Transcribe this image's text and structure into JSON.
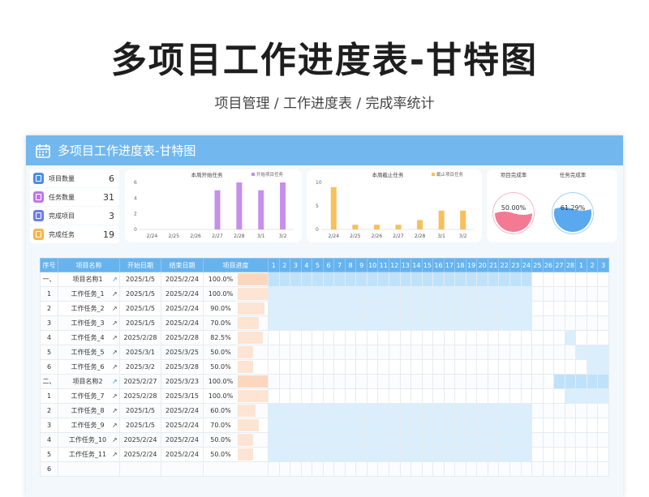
{
  "page": {
    "title": "多项目工作进度表-甘特图",
    "subtitle": "项目管理 / 工作进度表 / 完成率统计"
  },
  "window": {
    "title": "多项目工作进度表-甘特图",
    "icon": "calendar-icon"
  },
  "stats": [
    {
      "label": "项目数量",
      "value": "6",
      "color": "#4a8fe8"
    },
    {
      "label": "任务数量",
      "value": "31",
      "color": "#c077e6"
    },
    {
      "label": "完成项目",
      "value": "3",
      "color": "#6b7ee8"
    },
    {
      "label": "完成任务",
      "value": "19",
      "color": "#f5b54a"
    }
  ],
  "chart_data": [
    {
      "type": "bar",
      "title": "本周开始任务",
      "legend": "开始项目任务",
      "categories": [
        "2/24",
        "2/25",
        "2/26",
        "2/27",
        "2/28",
        "3/1",
        "3/2"
      ],
      "values": [
        0,
        0,
        0,
        5,
        6,
        5,
        6
      ],
      "ylim": [
        0,
        6
      ],
      "yticks": [
        0,
        2,
        4,
        6
      ],
      "color": "#c68fec"
    },
    {
      "type": "bar",
      "title": "本周截止任务",
      "legend": "截止项目任务",
      "categories": [
        "2/24",
        "2/25",
        "2/26",
        "2/27",
        "2/28",
        "3/1",
        "3/2"
      ],
      "values": [
        9,
        1,
        1,
        1,
        2,
        4,
        4
      ],
      "ylim": [
        0,
        10
      ],
      "yticks": [
        0,
        5,
        10
      ],
      "color": "#f8bf5c"
    }
  ],
  "gauges": [
    {
      "title": "项目完成率",
      "value": 0.5,
      "label": "50.00%",
      "color": "#f47a94"
    },
    {
      "title": "任务完成率",
      "value": 0.6129,
      "label": "61.29%",
      "color": "#5aa9ee"
    }
  ],
  "table": {
    "headers": [
      "序号",
      "项目名称",
      "开始日期",
      "结束日期",
      "项目进度"
    ],
    "days": [
      "1",
      "2",
      "3",
      "4",
      "5",
      "6",
      "7",
      "8",
      "9",
      "10",
      "11",
      "12",
      "13",
      "14",
      "15",
      "16",
      "17",
      "18",
      "19",
      "20",
      "21",
      "22",
      "23",
      "24",
      "25",
      "26",
      "27",
      "28",
      "1",
      "2",
      "3"
    ],
    "rows": [
      {
        "no": "一、",
        "name": "项目名称1",
        "start": "2025/1/5",
        "end": "2025/2/24",
        "pct": "100.0%",
        "p": 1.0,
        "proj": true,
        "on": [
          1,
          24
        ],
        "dark": true
      },
      {
        "no": "1",
        "name": "工作任务_1",
        "start": "2025/1/5",
        "end": "2025/2/24",
        "pct": "100.0%",
        "p": 1.0,
        "on": [
          1,
          24
        ]
      },
      {
        "no": "2",
        "name": "工作任务_2",
        "start": "2025/1/5",
        "end": "2025/2/24",
        "pct": "90.0%",
        "p": 0.9,
        "on": [
          1,
          24
        ]
      },
      {
        "no": "3",
        "name": "工作任务_3",
        "start": "2025/1/5",
        "end": "2025/2/24",
        "pct": "70.0%",
        "p": 0.7,
        "on": [
          1,
          24
        ]
      },
      {
        "no": "4",
        "name": "工作任务_4",
        "start": "2025/2/28",
        "end": "2025/2/28",
        "pct": "82.5%",
        "p": 0.825,
        "on": [
          28,
          28
        ]
      },
      {
        "no": "5",
        "name": "工作任务_5",
        "start": "2025/3/1",
        "end": "2025/3/25",
        "pct": "50.0%",
        "p": 0.5,
        "on": [
          29,
          31
        ]
      },
      {
        "no": "6",
        "name": "工作任务_6",
        "start": "2025/3/2",
        "end": "2025/3/28",
        "pct": "50.0%",
        "p": 0.5,
        "on": [
          30,
          31
        ]
      },
      {
        "no": "二、",
        "name": "项目名称2",
        "start": "2025/2/27",
        "end": "2025/3/23",
        "pct": "100.0%",
        "p": 1.0,
        "proj": true,
        "on": [
          27,
          31
        ],
        "dark": true
      },
      {
        "no": "1",
        "name": "工作任务_7",
        "start": "2025/2/28",
        "end": "2025/3/15",
        "pct": "100.0%",
        "p": 1.0,
        "on": [
          28,
          31
        ]
      },
      {
        "no": "2",
        "name": "工作任务_8",
        "start": "2025/1/5",
        "end": "2025/2/24",
        "pct": "60.0%",
        "p": 0.6,
        "on": [
          1,
          24
        ]
      },
      {
        "no": "3",
        "name": "工作任务_9",
        "start": "2025/1/5",
        "end": "2025/2/24",
        "pct": "70.0%",
        "p": 0.7,
        "on": [
          1,
          24
        ]
      },
      {
        "no": "4",
        "name": "工作任务_10",
        "start": "2025/2/24",
        "end": "2025/2/24",
        "pct": "50.0%",
        "p": 0.5,
        "on": [
          1,
          24
        ]
      },
      {
        "no": "5",
        "name": "工作任务_11",
        "start": "2025/2/24",
        "end": "2025/2/24",
        "pct": "50.0%",
        "p": 0.5,
        "on": [
          1,
          24
        ]
      },
      {
        "no": "6",
        "name": "",
        "start": "",
        "end": "",
        "pct": "",
        "p": 0,
        "on": null
      }
    ]
  }
}
